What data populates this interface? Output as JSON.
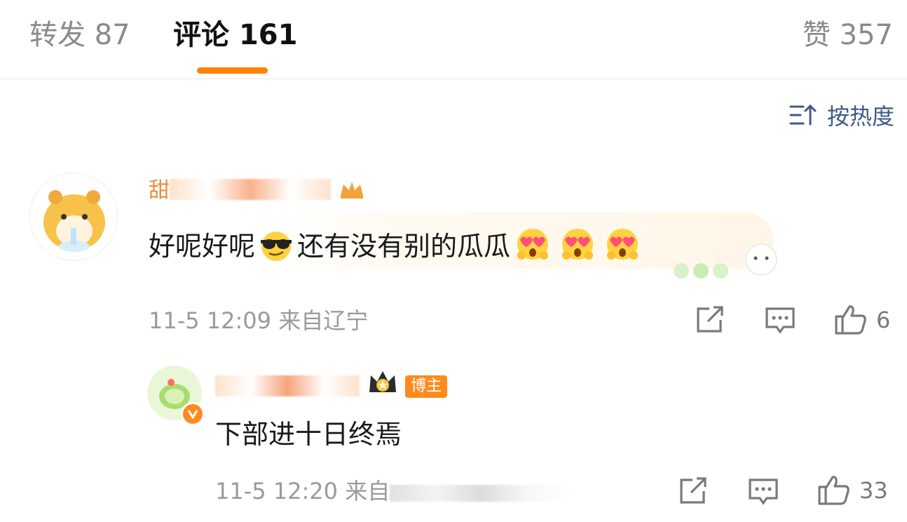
{
  "tabs": {
    "repost": {
      "label": "转发",
      "count": "87"
    },
    "comments": {
      "label": "评论",
      "count": "161"
    },
    "likes": {
      "label": "赞",
      "count": "357"
    }
  },
  "sort": {
    "label": "按热度",
    "icon": "sort-icon"
  },
  "comments": [
    {
      "username": "甜",
      "badge_icon": "crown-icon",
      "text_part1": "好呢好呢",
      "emoji1": "sunglasses-emoji",
      "text_part2": "还有没有别的瓜瓜",
      "emoji_trailing": [
        "heart-eyes-emoji",
        "heart-eyes-emoji",
        "heart-eyes-emoji"
      ],
      "time": "11-5 12:09",
      "location": "来自辽宁",
      "like_count": "6"
    },
    {
      "username": "",
      "badge_label": "博主",
      "text": "下部进十日终焉",
      "time": "11-5 12:20",
      "location": "来自",
      "like_count": "33"
    }
  ],
  "colors": {
    "accent": "#ff8200",
    "username": "#e98b3d",
    "link_blue": "#3d5a8a",
    "meta_gray": "#9a9a9a"
  }
}
